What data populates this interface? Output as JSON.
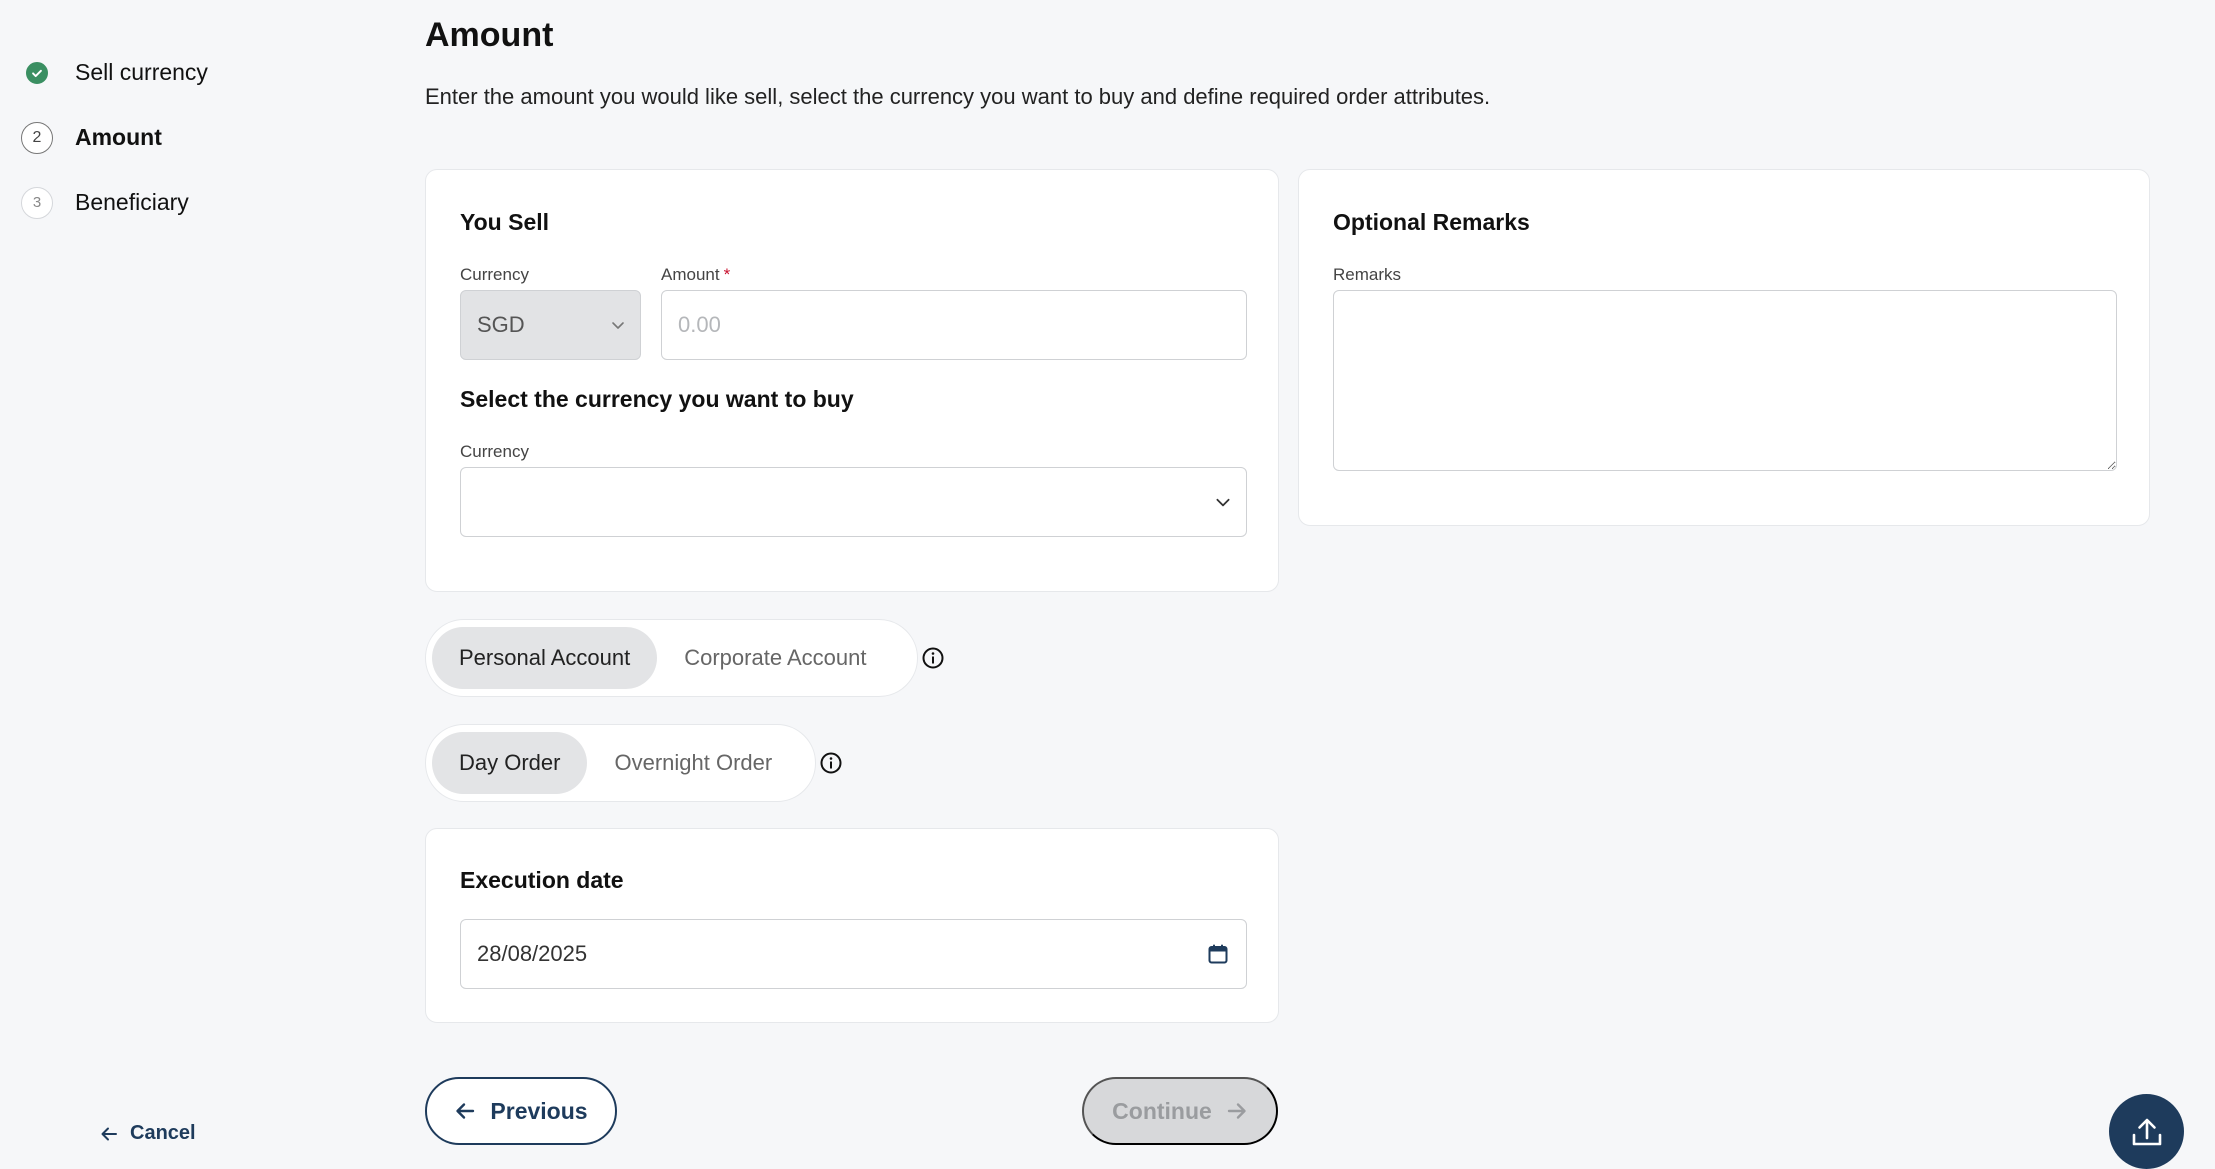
{
  "stepper": {
    "steps": [
      {
        "label": "Sell currency",
        "marker": "check-icon",
        "status": "done"
      },
      {
        "label": "Amount",
        "marker": "2",
        "status": "active"
      },
      {
        "label": "Beneficiary",
        "marker": "3",
        "status": "pending"
      }
    ],
    "cancel_label": "Cancel"
  },
  "header": {
    "title": "Amount",
    "description": "Enter the amount you would like sell, select the currency you want to buy and define required order attributes."
  },
  "sell_card": {
    "title": "You Sell",
    "currency_label": "Currency",
    "currency_value": "SGD",
    "amount_label": "Amount",
    "amount_required_mark": "*",
    "amount_placeholder": "0.00",
    "buy_title": "Select the currency you want to buy",
    "buy_currency_label": "Currency",
    "buy_currency_value": ""
  },
  "remarks_card": {
    "title": "Optional Remarks",
    "remarks_label": "Remarks",
    "remarks_value": ""
  },
  "account_toggle": {
    "options": [
      "Personal Account",
      "Corporate Account"
    ],
    "selected": "Personal Account"
  },
  "order_toggle": {
    "options": [
      "Day Order",
      "Overnight Order"
    ],
    "selected": "Day Order"
  },
  "execution_card": {
    "title": "Execution date",
    "date_value": "28/08/2025"
  },
  "footer": {
    "previous_label": "Previous",
    "continue_label": "Continue"
  },
  "colors": {
    "accent": "#1e3b5c",
    "success": "#3a8f62",
    "required": "#c8102e",
    "disabled_bg": "#d7d8da"
  }
}
